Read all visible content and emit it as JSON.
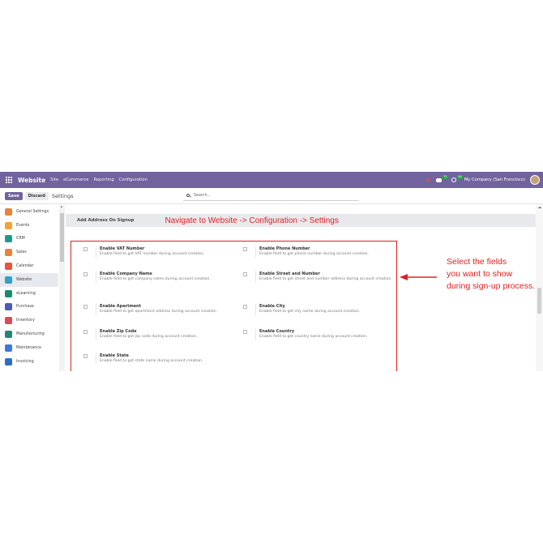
{
  "topbar": {
    "app_name": "Website",
    "menu": [
      "Site",
      "eCommerce",
      "Reporting",
      "Configuration"
    ],
    "chat_badge": "71",
    "activity_badge": "40",
    "company": "My Company (San Francisco)",
    "color": "#71639e"
  },
  "control": {
    "save_label": "Save",
    "discard_label": "Discard",
    "title": "Settings",
    "search_placeholder": "Search..."
  },
  "sidebar": {
    "items": [
      {
        "label": "General Settings",
        "icon": "gear-icon",
        "color": "#e8833a"
      },
      {
        "label": "Events",
        "icon": "events-icon",
        "color": "#f0a33a"
      },
      {
        "label": "CRM",
        "icon": "crm-icon",
        "color": "#1a9b8c"
      },
      {
        "label": "Sales",
        "icon": "sales-icon",
        "color": "#e8833a"
      },
      {
        "label": "Calendar",
        "icon": "calendar-icon",
        "color": "#e7553a"
      },
      {
        "label": "Website",
        "icon": "website-icon",
        "color": "#2fa3c9"
      },
      {
        "label": "eLearning",
        "icon": "elearning-icon",
        "color": "#1f8a70"
      },
      {
        "label": "Purchase",
        "icon": "purchase-icon",
        "color": "#4b59b8"
      },
      {
        "label": "Inventory",
        "icon": "inventory-icon",
        "color": "#d84a5a"
      },
      {
        "label": "Manufacturing",
        "icon": "manufacturing-icon",
        "color": "#1f8a70"
      },
      {
        "label": "Maintenance",
        "icon": "maintenance-icon",
        "color": "#3b7bd6"
      },
      {
        "label": "Invoicing",
        "icon": "invoicing-icon",
        "color": "#2d6fc4"
      }
    ],
    "active_index": 5
  },
  "section": {
    "title": "Add Address On Signup"
  },
  "annotations": {
    "nav_note": "Navigate to Website -> Configuration -> Settings",
    "side_note": [
      "Select the fields",
      "you want to show",
      "during sign-up process."
    ],
    "accent": "#e02020"
  },
  "settings": [
    {
      "title": "Enable VAT Number",
      "desc": "Enable field to get VAT number during account creation."
    },
    {
      "title": "Enable Phone Number",
      "desc": "Enable field to get phone number during account creation."
    },
    {
      "title": "Enable Company Name",
      "desc": "Enable field to get company name during account creation."
    },
    {
      "title": "Enable Street and Number",
      "desc": "Enable field to get street and number address during account creation."
    },
    {
      "title": "Enable Apartment",
      "desc": "Enable field to get apartment address during account creation."
    },
    {
      "title": "Enable City",
      "desc": "Enable field to get city name during account creation."
    },
    {
      "title": "Enable Zip Code",
      "desc": "Enable field to get zip code during account creation."
    },
    {
      "title": "Enable Country",
      "desc": "Enable field to get country name during account creation."
    },
    {
      "title": "Enable State",
      "desc": "Enable field to get state name during account creation."
    }
  ]
}
